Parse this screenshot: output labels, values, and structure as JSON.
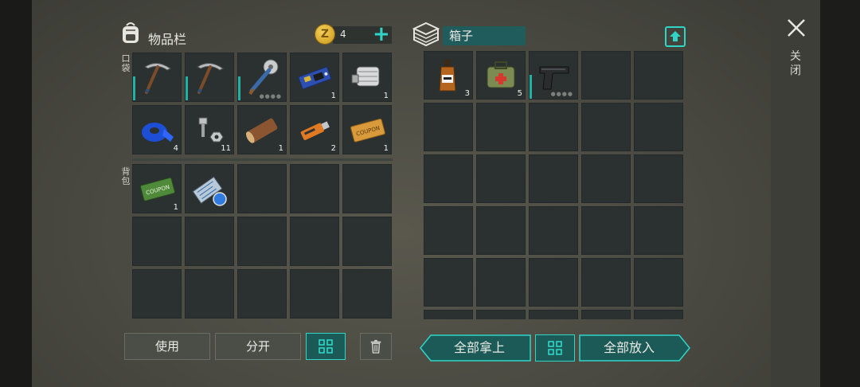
{
  "inventory": {
    "title": "物品栏",
    "pocket_label": "口袋",
    "backpack_label": "背包",
    "coins": "4",
    "add_label": "+",
    "pocket_slots": [
      {
        "icon": "pickaxe-icon",
        "qty": "",
        "bar": true,
        "dots": false
      },
      {
        "icon": "pickaxe-icon",
        "qty": "",
        "bar": true,
        "dots": false
      },
      {
        "icon": "saw-mace-icon",
        "qty": "",
        "bar": true,
        "dots": true
      },
      {
        "icon": "circuit-board-icon",
        "qty": "1",
        "bar": false,
        "dots": false
      },
      {
        "icon": "engine-block-icon",
        "qty": "1",
        "bar": false,
        "dots": false
      },
      {
        "icon": "duct-tape-icon",
        "qty": "4",
        "bar": false,
        "dots": false
      },
      {
        "icon": "nuts-bolts-icon",
        "qty": "11",
        "bar": false,
        "dots": false
      },
      {
        "icon": "wood-log-icon",
        "qty": "1",
        "bar": false,
        "dots": false
      },
      {
        "icon": "usb-drive-icon",
        "qty": "2",
        "bar": false,
        "dots": false
      },
      {
        "icon": "coupon-ticket-icon",
        "qty": "1",
        "bar": false,
        "dots": false
      }
    ],
    "backpack_slots": [
      {
        "icon": "ration-coupon-icon",
        "qty": "1"
      },
      {
        "icon": "blueprint-scroll-icon",
        "qty": ""
      },
      {
        "icon": "",
        "qty": ""
      },
      {
        "icon": "",
        "qty": ""
      },
      {
        "icon": "",
        "qty": ""
      },
      {
        "icon": "",
        "qty": ""
      },
      {
        "icon": "",
        "qty": ""
      },
      {
        "icon": "",
        "qty": ""
      },
      {
        "icon": "",
        "qty": ""
      },
      {
        "icon": "",
        "qty": ""
      },
      {
        "icon": "",
        "qty": ""
      },
      {
        "icon": "",
        "qty": ""
      },
      {
        "icon": "",
        "qty": ""
      },
      {
        "icon": "",
        "qty": ""
      },
      {
        "icon": "",
        "qty": ""
      }
    ]
  },
  "box": {
    "title": "箱子",
    "slots_filled": [
      {
        "icon": "whiskey-bottle-icon",
        "qty": "3",
        "bar": false,
        "dots": false
      },
      {
        "icon": "first-aid-kit-icon",
        "qty": "5",
        "bar": false,
        "dots": false
      },
      {
        "icon": "pistol-icon",
        "qty": "",
        "bar": true,
        "dots": true
      }
    ]
  },
  "buttons": {
    "use": "使用",
    "split": "分开",
    "take_all": "全部拿上",
    "put_all": "全部放入",
    "close": "关闭"
  },
  "colors": {
    "accent": "#2fd6c8",
    "slot": "#2b3130",
    "teal_button": "#1b5a57"
  }
}
